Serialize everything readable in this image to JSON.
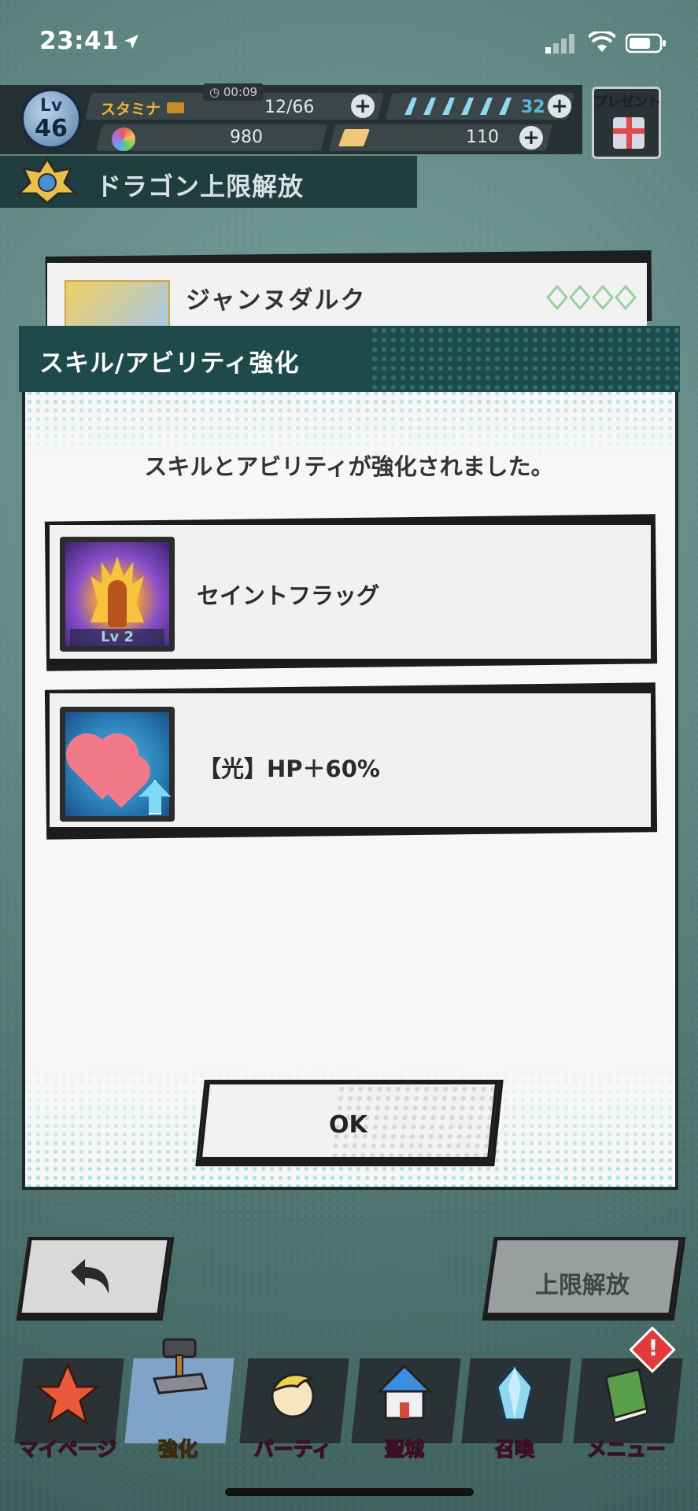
{
  "status_bar": {
    "time": "23:41"
  },
  "hud": {
    "level_label": "Lv",
    "level_value": "46",
    "stamina_label": "スタミナ",
    "stamina_timer": "00:09",
    "stamina_value": "12/66",
    "wings_value": "32",
    "gems_value": "980",
    "tickets_value": "110",
    "present_label": "プレゼント"
  },
  "page": {
    "title": "ドラゴン上限解放"
  },
  "character": {
    "name": "ジャンヌダルク"
  },
  "modal": {
    "title": "スキル/アビリティ強化",
    "message": "スキルとアビリティが強化されました。",
    "skills": [
      {
        "name": "セイントフラッグ",
        "level_badge": "Lv 2",
        "icon": "saint-flag-icon"
      },
      {
        "name": "【光】HP＋60%",
        "icon": "hp-up-icon"
      }
    ],
    "ok_label": "OK"
  },
  "actions": {
    "unlock_label": "上限解放"
  },
  "tabs": [
    {
      "label": "マイページ",
      "icon": "mypage-icon",
      "active": false
    },
    {
      "label": "強化",
      "icon": "enhance-icon",
      "active": true
    },
    {
      "label": "パーティ",
      "icon": "party-icon",
      "active": false
    },
    {
      "label": "聖城",
      "icon": "castle-icon",
      "active": false
    },
    {
      "label": "召喚",
      "icon": "summon-icon",
      "active": false
    },
    {
      "label": "メニュー",
      "icon": "menu-book-icon",
      "active": false
    }
  ],
  "menu_badge": "!",
  "colors": {
    "accent_teal": "#1f4a4b",
    "stamina_orange": "#f3b43a",
    "wings_blue": "#5ab9d6",
    "badge_red": "#e33b3b",
    "tab_label_pink": "#f06a8a"
  }
}
